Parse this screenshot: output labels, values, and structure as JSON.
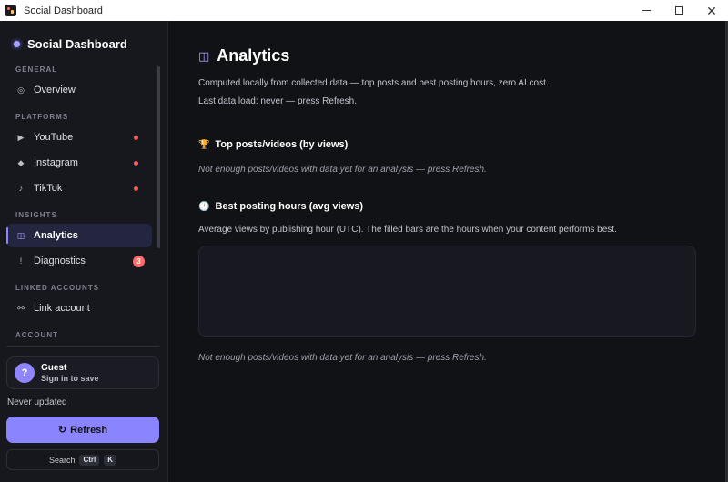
{
  "window": {
    "title": "Social Dashboard",
    "controls": {
      "minimize_icon": "minimize-icon",
      "maximize_icon": "maximize-icon",
      "close_icon": "close-icon",
      "close_glyph": "✕"
    }
  },
  "sidebar": {
    "brand": "Social Dashboard",
    "sections": [
      {
        "title": "GENERAL",
        "items": [
          {
            "label": "Overview",
            "icon": "◎",
            "icon_name": "overview-icon"
          }
        ]
      },
      {
        "title": "PLATFORMS",
        "items": [
          {
            "label": "YouTube",
            "icon": "▶",
            "icon_name": "play-icon",
            "dot": true
          },
          {
            "label": "Instagram",
            "icon": "◆",
            "icon_name": "diamond-icon",
            "dot": true
          },
          {
            "label": "TikTok",
            "icon": "♪",
            "icon_name": "music-note-icon",
            "dot": true
          }
        ]
      },
      {
        "title": "INSIGHTS",
        "items": [
          {
            "label": "Analytics",
            "icon": "◫",
            "icon_name": "analytics-icon",
            "active": true
          },
          {
            "label": "Diagnostics",
            "icon": "ǃ",
            "icon_name": "diagnostics-icon",
            "badge": "3"
          }
        ]
      },
      {
        "title": "LINKED ACCOUNTS",
        "items": [
          {
            "label": "Link account",
            "icon": "⚯",
            "icon_name": "link-icon"
          }
        ]
      },
      {
        "title": "ACCOUNT",
        "items": []
      }
    ],
    "user": {
      "avatar": "?",
      "name": "Guest",
      "subtitle": "Sign in to save"
    },
    "last_updated": "Never updated",
    "refresh_label": "Refresh",
    "refresh_icon": "↻",
    "search": {
      "label": "Search",
      "key1": "Ctrl",
      "key2": "K"
    }
  },
  "main": {
    "title": "Analytics",
    "title_icon": "◫",
    "description": "Computed locally from collected data — top posts and best posting hours, zero AI cost.",
    "last_load": "Last data load: never — press Refresh.",
    "top_posts": {
      "icon": "🏆",
      "heading": "Top posts/videos (by views)",
      "empty": "Not enough posts/videos with data yet for an analysis — press Refresh."
    },
    "best_hours": {
      "icon": "🕘",
      "heading": "Best posting hours (avg views)",
      "description": "Average views by publishing hour (UTC). The filled bars are the hours when your content performs best.",
      "empty": "Not enough posts/videos with data yet for an analysis — press Refresh."
    }
  },
  "colors": {
    "accent": "#8b84ff",
    "background": "#111216",
    "sidebar": "#17181e",
    "status_dot": "#ff5a5a"
  }
}
